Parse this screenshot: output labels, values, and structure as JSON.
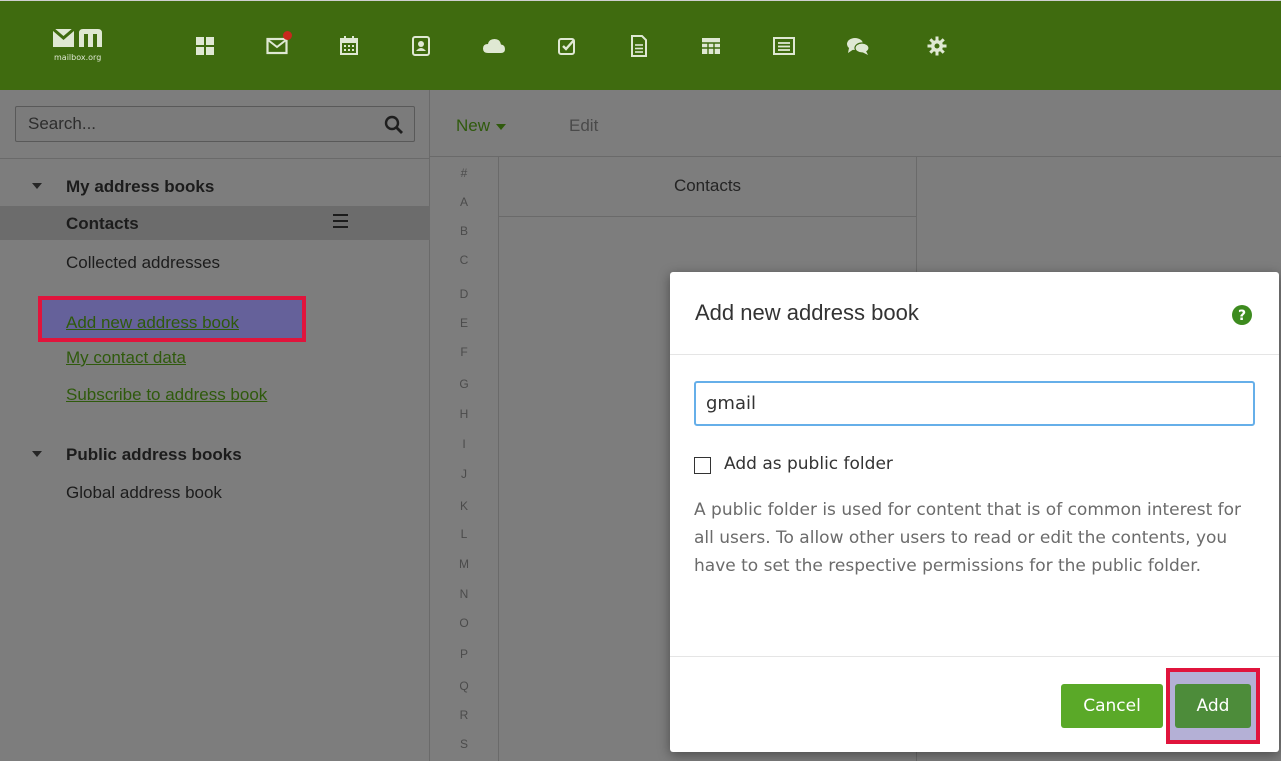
{
  "brand": {
    "logo_text": "mailbox.org"
  },
  "topbar": {
    "apps": [
      {
        "name": "portal",
        "icon": "grid-icon"
      },
      {
        "name": "mail",
        "icon": "mail-icon",
        "notification": true
      },
      {
        "name": "calendar",
        "icon": "calendar-icon"
      },
      {
        "name": "address-book",
        "icon": "contact-card-icon"
      },
      {
        "name": "drive",
        "icon": "cloud-icon"
      },
      {
        "name": "tasks",
        "icon": "checkbox-icon"
      },
      {
        "name": "documents",
        "icon": "document-icon"
      },
      {
        "name": "spreadsheets",
        "icon": "spreadsheet-icon"
      },
      {
        "name": "presentations",
        "icon": "presentation-icon"
      },
      {
        "name": "chat",
        "icon": "chat-icon"
      },
      {
        "name": "settings",
        "icon": "gear-icon"
      }
    ]
  },
  "search": {
    "placeholder": "Search..."
  },
  "sidebar": {
    "my_books_header": "My address books",
    "my_books": [
      {
        "label": "Contacts",
        "selected": true
      },
      {
        "label": "Collected addresses"
      }
    ],
    "links": [
      {
        "label": "Add new address book",
        "highlighted": true
      },
      {
        "label": "My contact data"
      },
      {
        "label": "Subscribe to address book"
      }
    ],
    "public_books_header": "Public address books",
    "public_books": [
      {
        "label": "Global address book"
      }
    ]
  },
  "toolbar": {
    "new_label": "New",
    "edit_label": "Edit"
  },
  "alphabet": [
    "#",
    "A",
    "B",
    "C",
    "D",
    "E",
    "F",
    "G",
    "H",
    "I",
    "J",
    "K",
    "L",
    "M",
    "N",
    "O",
    "P",
    "Q",
    "R",
    "S"
  ],
  "contacts_column": {
    "header": "Contacts"
  },
  "modal": {
    "title": "Add new address book",
    "input_value": "gmail",
    "public_checkbox_label": "Add as public folder",
    "public_checkbox_checked": false,
    "description": "A public folder is used for content that is of common interest for all users. To allow other users to read or edit the contents, you have to set the respective permissions for the public folder.",
    "cancel_label": "Cancel",
    "add_label": "Add"
  },
  "colors": {
    "topbar": "#3f6b0f",
    "highlight": "#e0143c",
    "button_green": "#5aa928",
    "link_green": "#2f5a0c"
  }
}
